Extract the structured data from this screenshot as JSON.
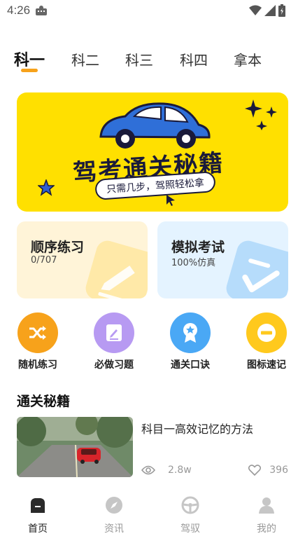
{
  "status": {
    "time": "4:26"
  },
  "tabs": [
    {
      "label": "科一",
      "active": true
    },
    {
      "label": "科二"
    },
    {
      "label": "科三"
    },
    {
      "label": "科四"
    },
    {
      "label": "拿本"
    }
  ],
  "banner": {
    "title": "驾考通关秘籍",
    "subtitle": "只需几步，驾照轻松拿"
  },
  "cards": [
    {
      "title": "顺序练习",
      "subtitle": "0/707",
      "icon": "pencil-icon"
    },
    {
      "title": "模拟考试",
      "subtitle": "100%仿真",
      "icon": "check-icon"
    }
  ],
  "quick_actions": [
    {
      "label": "随机练习",
      "icon": "shuffle-icon",
      "color": "#f7a21b"
    },
    {
      "label": "必做习题",
      "icon": "edit-note-icon",
      "color": "#b79af2"
    },
    {
      "label": "通关口诀",
      "icon": "award-icon",
      "color": "#4aa8f5"
    },
    {
      "label": "图标速记",
      "icon": "minus-circle-icon",
      "color": "#ffc91d"
    }
  ],
  "section": {
    "title": "通关秘籍"
  },
  "article": {
    "title": "科目一高效记忆的方法",
    "views": "2.8w",
    "likes": "396"
  },
  "bottom_nav": [
    {
      "label": "首页",
      "icon": "home-icon",
      "active": true
    },
    {
      "label": "资讯",
      "icon": "compass-icon"
    },
    {
      "label": "驾驭",
      "icon": "steering-wheel-icon"
    },
    {
      "label": "我的",
      "icon": "user-icon"
    }
  ]
}
